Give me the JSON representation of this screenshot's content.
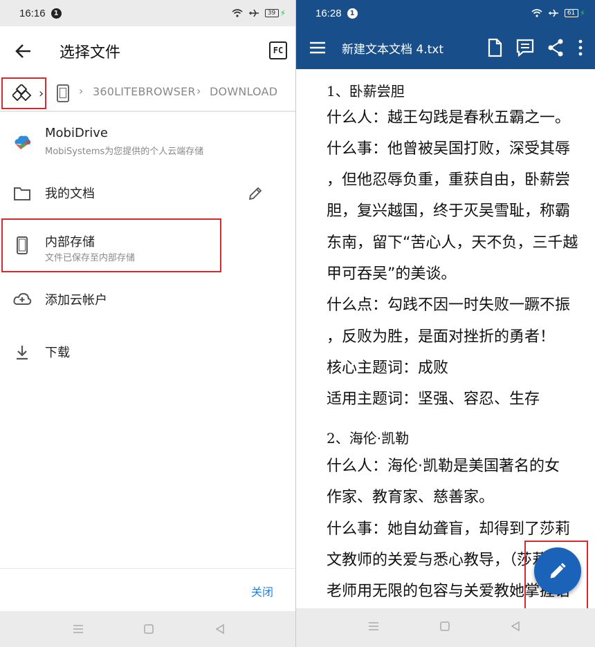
{
  "left": {
    "status": {
      "time": "16:16",
      "notif": "1",
      "battery": "39"
    },
    "title": "选择文件",
    "fc_label": "FC",
    "breadcrumbs": [
      "360LITEBROWSER",
      "DOWNLOAD"
    ],
    "items": [
      {
        "title": "MobiDrive",
        "subtitle": "MobiSystems为您提供的个人云端存储"
      },
      {
        "title": "我的文档",
        "subtitle": ""
      },
      {
        "title": "内部存储",
        "subtitle": "文件已保存至内部存储"
      },
      {
        "title": "添加云帐户",
        "subtitle": ""
      },
      {
        "title": "下载",
        "subtitle": ""
      }
    ],
    "close_label": "关闭",
    "colors": {
      "accent": "#2a7fd4",
      "highlight": "#d6282e"
    }
  },
  "right": {
    "status": {
      "time": "16:28",
      "notif": "1",
      "battery": "61"
    },
    "title": "新建文本文档 4.txt",
    "colors": {
      "appbar": "#184f8a",
      "fab": "#1a63b8"
    },
    "lines": [
      "1、卧薪尝胆",
      "什么人：越王勾践是春秋五霸之一。",
      "什么事：他曾被吴国打败，深受其辱",
      "，但他忍辱负重，重获自由，卧薪尝",
      "胆，复兴越国，终于灭吴雪耻，称霸",
      "东南，留下“苦心人，天不负，三千越",
      "甲可吞吴”的美谈。",
      "什么点：勾践不因一时失败一蹶不振",
      "，反败为胜，是面对挫折的勇者！",
      "核心主题词：成败",
      "适用主题词：坚强、容忍、生存",
      "2、海伦·凯勒",
      "什么人：海伦·凯勒是美国著名的女",
      "作家、教育家、慈善家。",
      "什么事：她自幼聋盲，却得到了莎莉",
      "文教师的关爱与悉心教导，（莎莉文",
      "老师用无限的包容与关爱教她掌握语"
    ]
  }
}
